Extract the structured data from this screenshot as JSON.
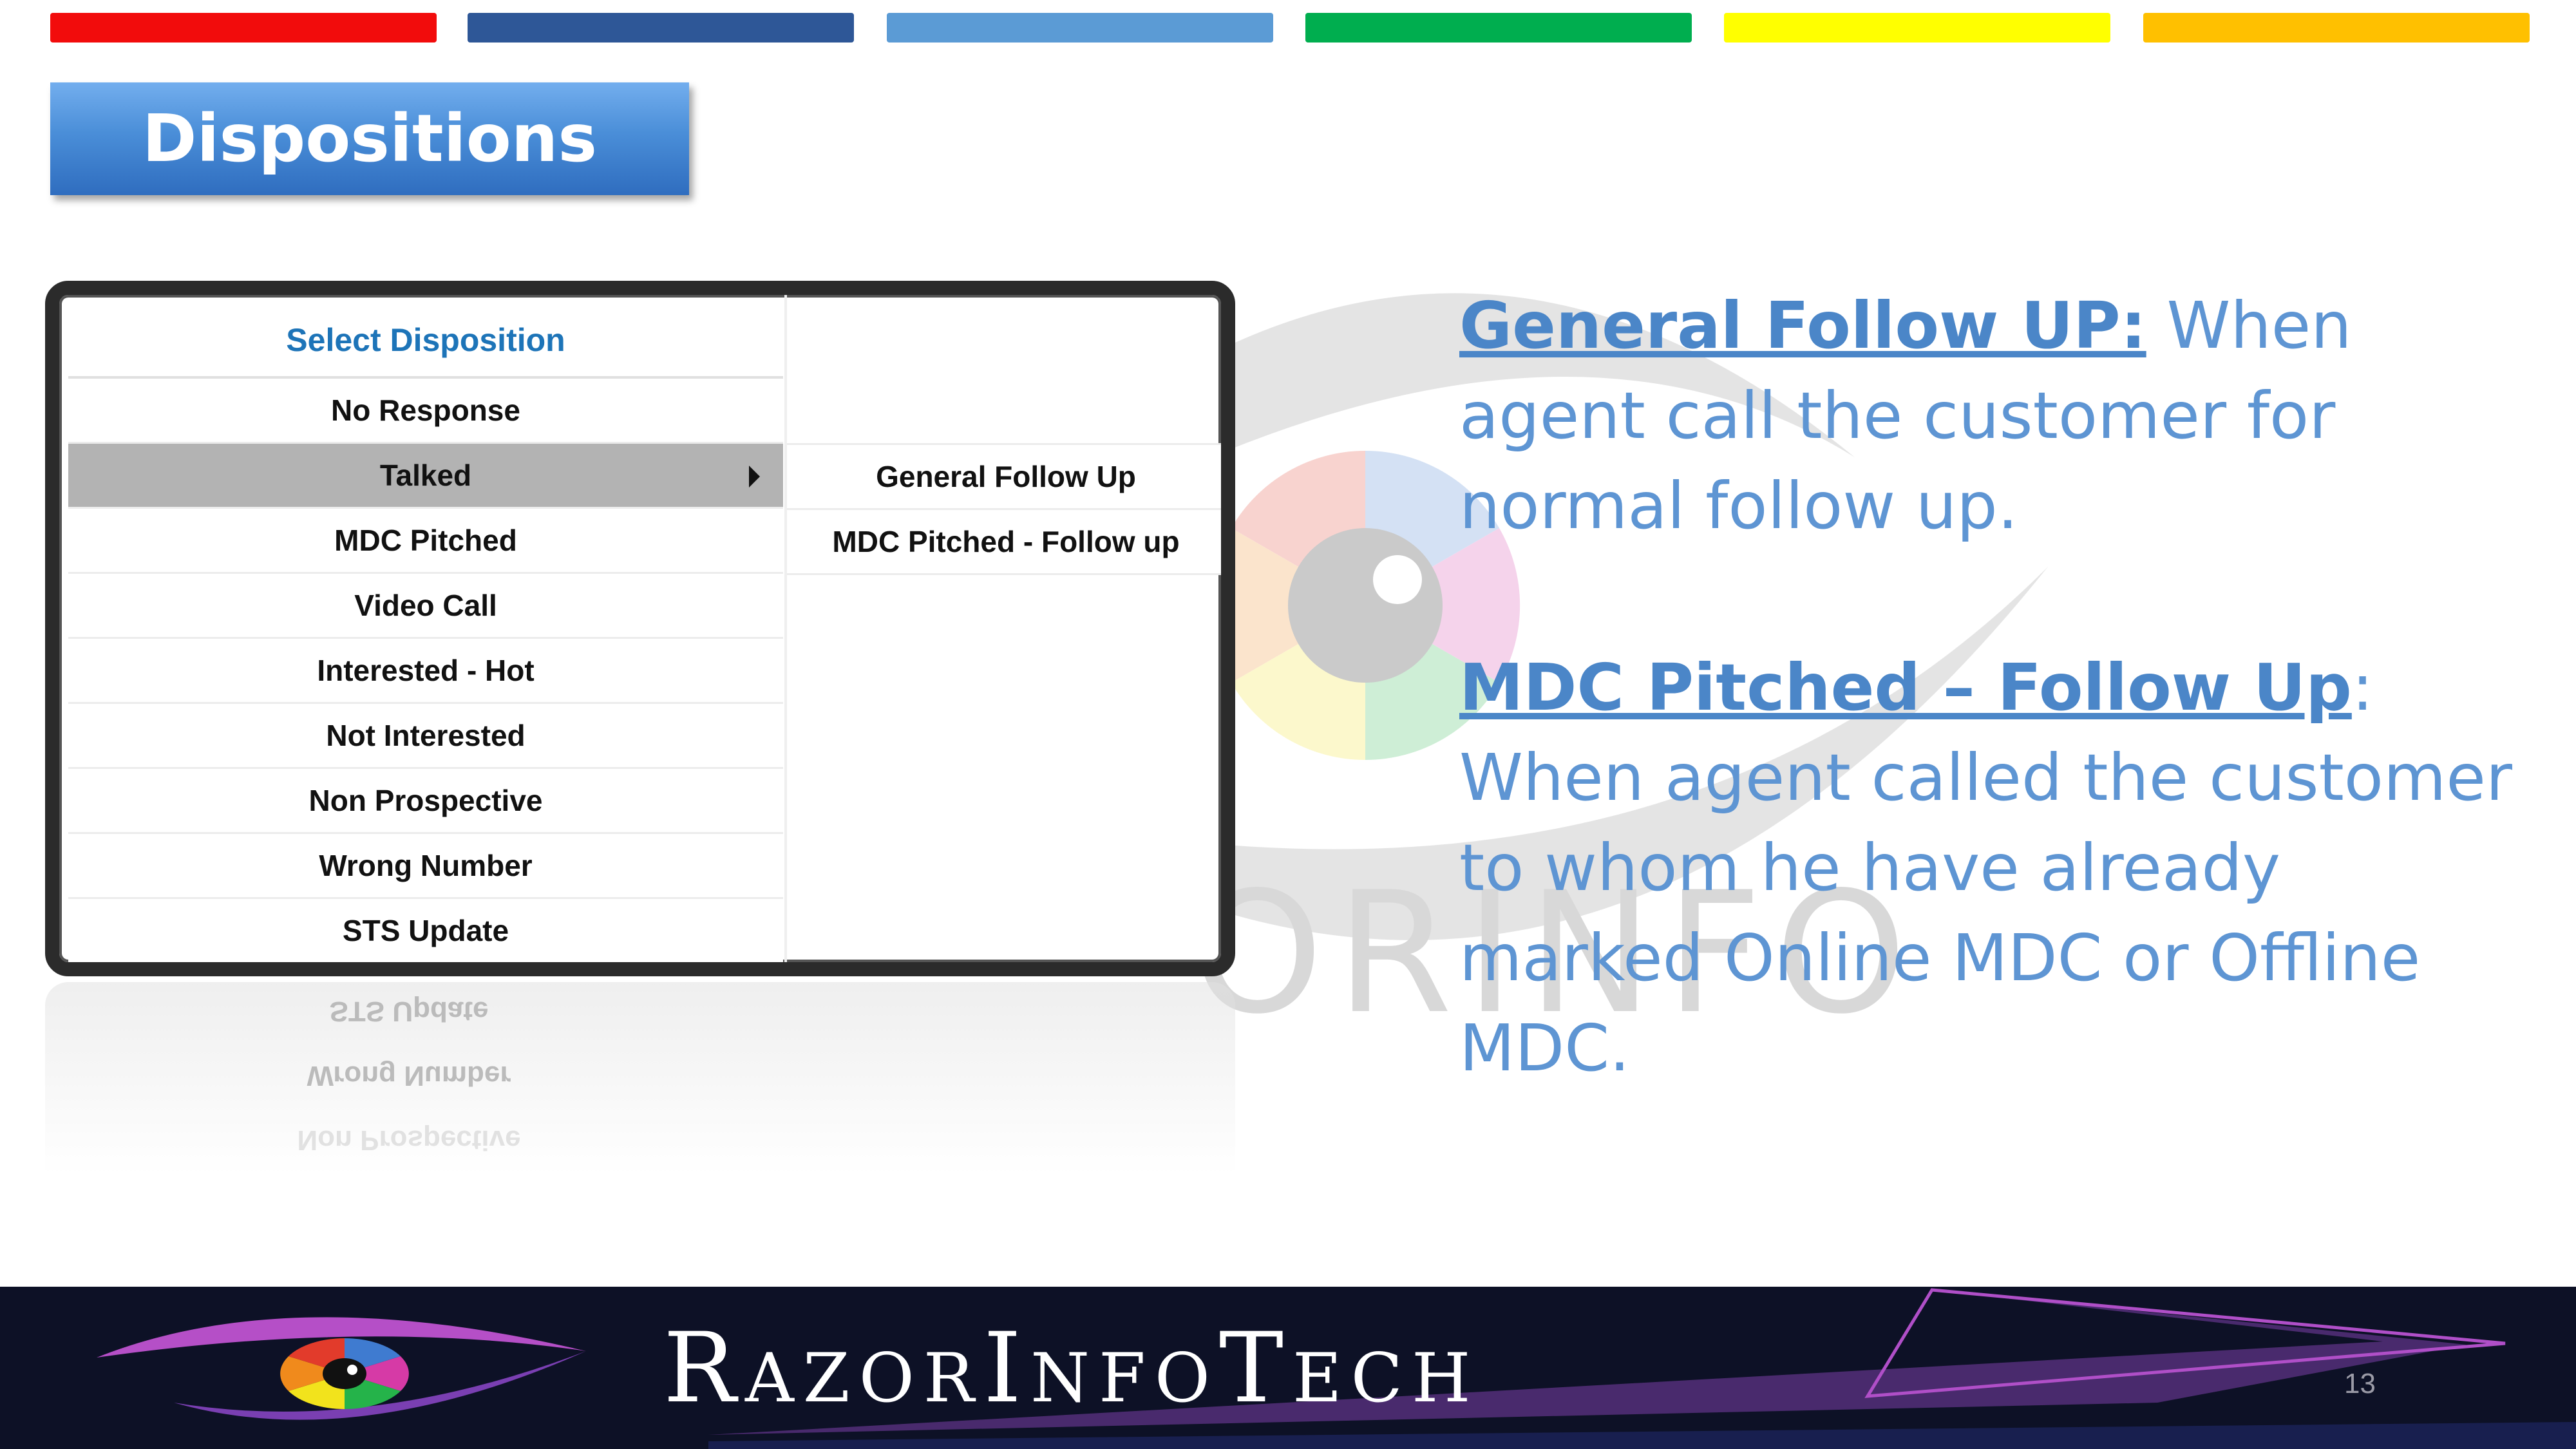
{
  "colors": {
    "top_bars": [
      "#f20c0c",
      "#2e5797",
      "#5b9bd5",
      "#00ae4f",
      "#ffff00",
      "#ffc000"
    ],
    "title_bg": "#4a8ed8",
    "description_text": "#5e95d3",
    "footer_bg": "#0d1126"
  },
  "slide": {
    "title": "Dispositions",
    "page_number": "13"
  },
  "disposition_menu": {
    "header": "Select Disposition",
    "items": [
      "No Response",
      "Talked",
      "MDC Pitched",
      "Video Call",
      "Interested - Hot",
      "Not Interested",
      "Non Prospective",
      "Wrong Number",
      "STS Update"
    ],
    "selected": "Talked",
    "submenu": [
      "General Follow Up",
      "MDC Pitched - Follow up"
    ]
  },
  "descriptions": [
    {
      "term": "General Follow UP:",
      "text": " When agent call the customer for normal follow up."
    },
    {
      "term": "MDC Pitched – Follow Up",
      "text": ": When agent called the customer to whom he have already marked Online MDC or Offline MDC."
    }
  ],
  "footer": {
    "brand_parts": [
      "Razor",
      "Info",
      "Tech"
    ],
    "watermark": "ORINFO"
  }
}
